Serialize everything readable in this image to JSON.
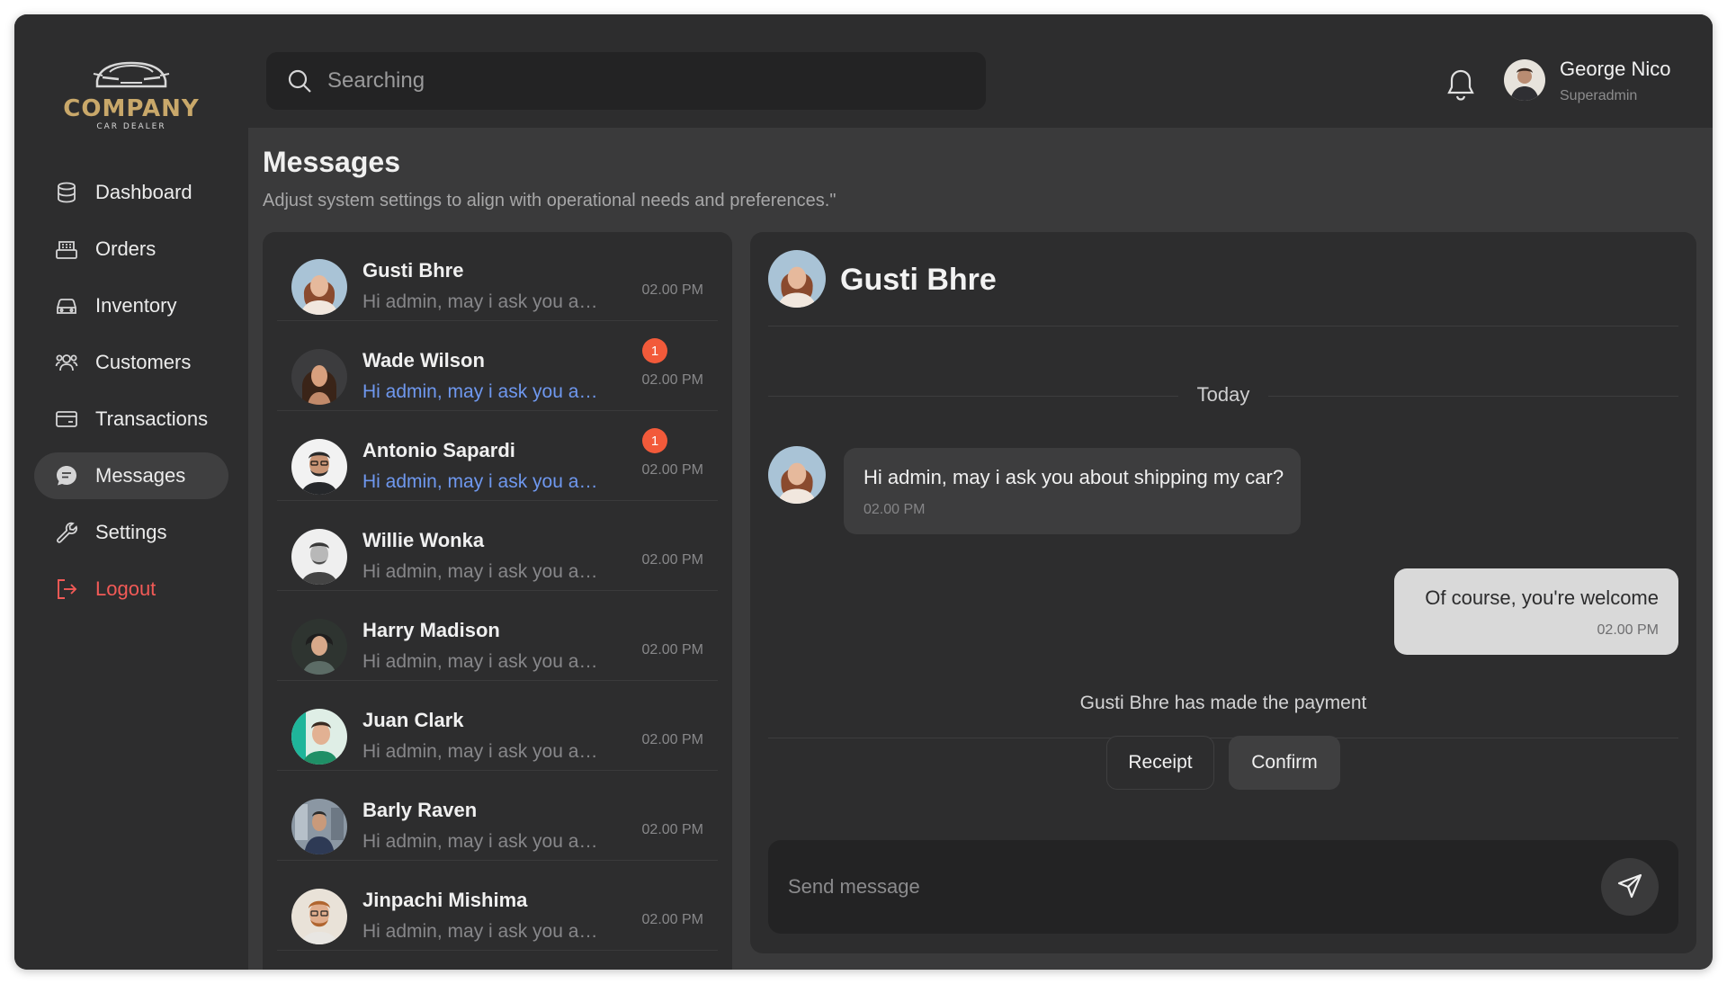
{
  "brand": {
    "name": "COMPANY",
    "tagline": "CAR DEALER",
    "icon": "car-logo-icon"
  },
  "sidebar": {
    "items": [
      {
        "label": "Dashboard",
        "icon": "database-icon",
        "active": false
      },
      {
        "label": "Orders",
        "icon": "cash-register-icon",
        "active": false
      },
      {
        "label": "Inventory",
        "icon": "car-icon",
        "active": false
      },
      {
        "label": "Customers",
        "icon": "users-icon",
        "active": false
      },
      {
        "label": "Transactions",
        "icon": "card-icon",
        "active": false
      },
      {
        "label": "Messages",
        "icon": "chat-icon",
        "active": true
      },
      {
        "label": "Settings",
        "icon": "wrench-icon",
        "active": false
      }
    ],
    "logout": {
      "label": "Logout",
      "icon": "logout-icon"
    }
  },
  "header": {
    "search_placeholder": "Searching",
    "user": {
      "name": "George Nico",
      "role": "Superadmin"
    }
  },
  "page": {
    "title": "Messages",
    "subtitle": "Adjust system settings to align with operational needs and preferences.\""
  },
  "conversations": [
    {
      "name": "Gusti Bhre",
      "preview": "Hi admin, may i ask you about shipping my car?",
      "time": "02.00 PM",
      "unread": 0
    },
    {
      "name": "Wade Wilson",
      "preview": "Hi admin, may i ask you about shipping my car?",
      "time": "02.00 PM",
      "unread": 1
    },
    {
      "name": "Antonio Sapardi",
      "preview": "Hi admin, may i ask you about shipping my car?",
      "time": "02.00 PM",
      "unread": 1
    },
    {
      "name": "Willie Wonka",
      "preview": "Hi admin, may i ask you about shipping my car?",
      "time": "02.00 PM",
      "unread": 0
    },
    {
      "name": "Harry Madison",
      "preview": "Hi admin, may i ask you about shipping my car?",
      "time": "02.00 PM",
      "unread": 0
    },
    {
      "name": "Juan Clark",
      "preview": "Hi admin, may i ask you about shipping my car?",
      "time": "02.00 PM",
      "unread": 0
    },
    {
      "name": "Barly Raven",
      "preview": "Hi admin, may i ask you about shipping my car?",
      "time": "02.00 PM",
      "unread": 0
    },
    {
      "name": "Jinpachi Mishima",
      "preview": "Hi admin, may i ask you about shipping my car?",
      "time": "02.00 PM",
      "unread": 0
    }
  ],
  "chat": {
    "contact_name": "Gusti Bhre",
    "day_label": "Today",
    "messages": [
      {
        "direction": "incoming",
        "text": "Hi admin, may i ask you about shipping my car?",
        "time": "02.00 PM"
      },
      {
        "direction": "outgoing",
        "text": "Of course, you're welcome",
        "time": "02.00 PM"
      }
    ],
    "payment_note": "Gusti Bhre has made the payment",
    "receipt_label": "Receipt",
    "confirm_label": "Confirm",
    "composer_placeholder": "Send message"
  },
  "colors": {
    "accent_gold": "#c9a86a",
    "unread_blue": "#6f98ef",
    "badge_red": "#f25a3a",
    "logout_red": "#f25a57"
  }
}
